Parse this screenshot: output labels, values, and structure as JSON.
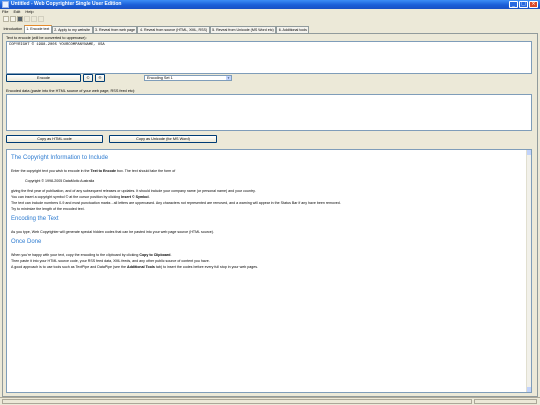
{
  "window": {
    "title": "Untitled - Web Copyrighter Single User Edition",
    "min_glyph": "_",
    "max_glyph": "□",
    "close_glyph": "×"
  },
  "menu": [
    "File",
    "Edit",
    "Help"
  ],
  "tabs": [
    {
      "label": "Introduction"
    },
    {
      "label": "1. Encode text"
    },
    {
      "label": "2. Apply to my website"
    },
    {
      "label": "3. Reveal from web page"
    },
    {
      "label": "4. Reveal from source (HTML, XML, RSS)"
    },
    {
      "label": "5. Reveal from Unicode (MS Word etc)"
    },
    {
      "label": "6. Additional tools"
    }
  ],
  "encode_section": {
    "label": "Text to encode (will be converted to uppercase):",
    "value": "COPYRIGHT © 1998-2005 YOURCOMPANYNAME, USA",
    "encode_button": "Encode",
    "copyright_button": "©",
    "registered_button": "®",
    "encoding_select": "Encoding Set 1"
  },
  "encoded_section": {
    "label": "Encoded data (paste into the HTML source of your web page, RSS feed etc):",
    "value": "",
    "copy_html_button": "Copy as HTML code",
    "copy_unicode_button": "Copy as Unicode (for MS Word)"
  },
  "help": {
    "heading1": "The Copyright Information to Include",
    "p1_a": "Enter the copyright text you wish to encode in the ",
    "p1_b": "Text to Encode",
    "p1_c": " box. The text should take the form of",
    "example": "Copyright © 1998-2005 DataMotic Australia",
    "p2": "giving the first year of publication, and of any subsequent releases or updates. It should include your company name (or personal name) and your country.",
    "p3_a": "You can insert a copyright symbol © at the cursor position by clicking ",
    "p3_b": "Insert © Symbol",
    "p3_c": ".",
    "p4": "The text can include numbers 0-9 and most punctuation marks - all letters are uppercased. Any characters not represented are removed, and a warning will appear in the Status Bar if any have been removed.",
    "p5": "Try to minimize the length of the encoded text.",
    "heading2": "Encoding the Text",
    "p6": "As you type, Web Copyrighter will generate special hidden codes that can be pasted into your web page source (HTML source).",
    "heading3": "Once Done",
    "p7_a": "When you're happy with your text, copy the encoding to the clipboard by clicking ",
    "p7_b": "Copy to Clipboard",
    "p7_c": ".",
    "p8": "Then paste it into your HTML source code, your RSS feed data, XML feeds, and any other public source of content you have.",
    "p9_a": "A good approach is to use tools such as TextPipe and DataPipe (see the ",
    "p9_b": "Additional Tools",
    "p9_c": " tab) to insert the codes before every full stop in your web pages."
  }
}
